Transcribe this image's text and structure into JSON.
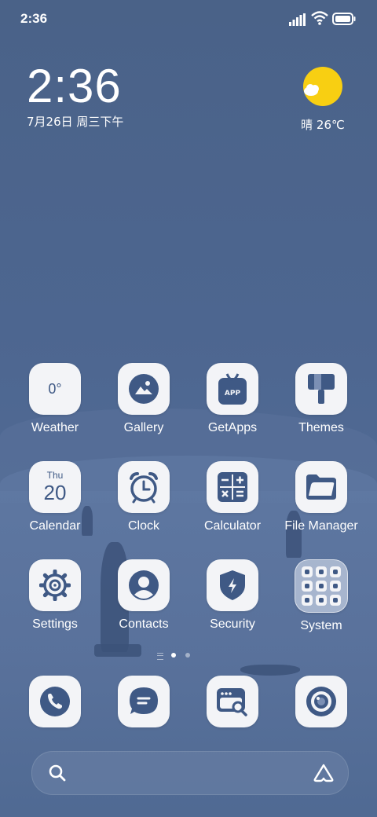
{
  "status_bar": {
    "time": "2:36"
  },
  "clock_widget": {
    "time": "2:36",
    "date": "7月26日 周三下午"
  },
  "weather_widget": {
    "text": "晴 26℃"
  },
  "apps": {
    "weather": {
      "label": "Weather",
      "temp": "0°"
    },
    "gallery": {
      "label": "Gallery"
    },
    "getapps": {
      "label": "GetApps",
      "badge": "APP"
    },
    "themes": {
      "label": "Themes"
    },
    "calendar": {
      "label": "Calendar",
      "weekday": "Thu",
      "day": "20"
    },
    "clock": {
      "label": "Clock"
    },
    "calculator": {
      "label": "Calculator"
    },
    "filemanager": {
      "label": "File Manager"
    },
    "settings": {
      "label": "Settings"
    },
    "contacts": {
      "label": "Contacts"
    },
    "security": {
      "label": "Security"
    },
    "system": {
      "label": "System"
    }
  },
  "page_indicator": {
    "pages": 2,
    "current": 1
  },
  "dock": [
    "phone",
    "messages",
    "browser",
    "camera"
  ],
  "colors": {
    "accent": "#3f5985",
    "tile": "#f3f4f7",
    "sun": "#f8cf12"
  }
}
